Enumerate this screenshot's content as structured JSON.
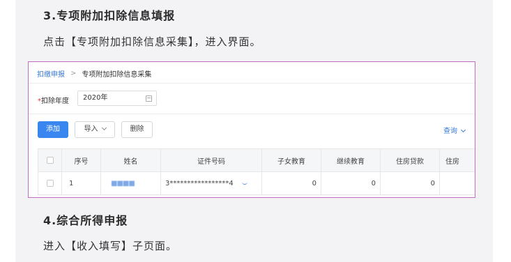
{
  "article": {
    "heading3": "3.专项附加扣除信息填报",
    "para1": "点击【专项附加扣除信息采集】，进入界面。",
    "heading4": "4.综合所得申报",
    "para2": "进入【收入填写】子页面。"
  },
  "breadcrumb": {
    "parent": "扣缴申报",
    "separator": ">",
    "current": "专项附加扣除信息采集"
  },
  "filter": {
    "year_label": "扣除年度",
    "year_value": "2020年"
  },
  "toolbar": {
    "add_label": "添加",
    "import_label": "导入",
    "delete_label": "删除",
    "query_label": "查询"
  },
  "table": {
    "headers": [
      "序号",
      "姓名",
      "证件号码",
      "子女教育",
      "继续教育",
      "住房贷款",
      "住房"
    ],
    "rows": [
      {
        "seq": "1",
        "name": "■■■■",
        "id": "3*****************4",
        "child_edu": "0",
        "cont_edu": "0",
        "housing_loan": "0",
        "housing_rent": ""
      }
    ]
  },
  "colors": {
    "accent": "#3a86f0",
    "link": "#3a7bd5",
    "frame": "#c46bc4"
  }
}
